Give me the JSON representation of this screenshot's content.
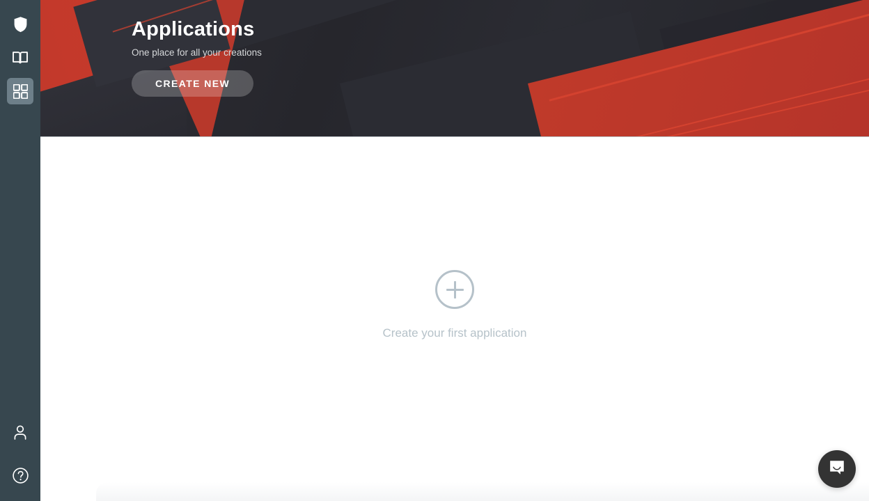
{
  "sidebar": {
    "background_color": "#37474f",
    "active_color": "#6d7f89",
    "top_items": [
      {
        "name": "shield-icon",
        "label": "Security",
        "active": false
      },
      {
        "name": "book-icon",
        "label": "Documentation",
        "active": false
      },
      {
        "name": "grid-icon",
        "label": "Applications",
        "active": true
      }
    ],
    "bottom_items": [
      {
        "name": "user-icon",
        "label": "Account"
      },
      {
        "name": "help-icon",
        "label": "Help"
      }
    ]
  },
  "banner": {
    "title": "Applications",
    "subtitle": "One place for all your creations",
    "create_button_label": "CREATE NEW",
    "accent_color": "#c0392b",
    "background_color": "#2b2c33"
  },
  "content": {
    "empty_state": {
      "icon": "plus-circle-icon",
      "label": "Create your first application",
      "color": "#b6c2c9"
    }
  },
  "chat": {
    "launcher_icon": "chat-bubble-icon",
    "launcher_color": "#333333"
  }
}
